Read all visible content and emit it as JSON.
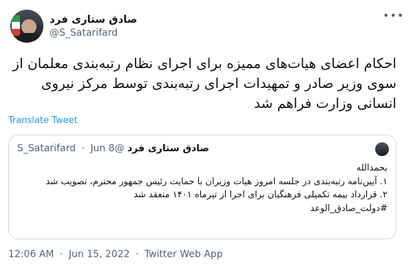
{
  "user": {
    "display_name": "صادق ستاری فرد",
    "handle": "@S_Satarifard"
  },
  "more_icon": "•••",
  "tweet": {
    "text": "احکام اعضای هیات‌های ممیزه برای اجرای نظام رتبه‌بندی معلمان از سوی وزیر صادر و تمهیدات اجرای رتبه‌بندی توسط مرکز نیروی انسانی وزارت فراهم شد"
  },
  "translate_label": "Translate Tweet",
  "quoted": {
    "display_name": "صادق ستاری فرد",
    "handle": "@S_Satarifard",
    "date": "Jun 8",
    "lines": [
      "بحمدالله",
      "۱. آیین‌نامه رتبه‌بندی در جلسه امروز هیات وزیران با حمایت رئیس جمهور محترم، تصویب شد",
      "۲. قرارداد بیمه تکمیلی فرهنگیان برای اجرا از تیرماه ۱۴۰۱ منعقد شد",
      "#دولت_صادق_الوعد"
    ]
  },
  "footer": {
    "time": "12:06 AM",
    "date": "Jun 15, 2022",
    "source": "Twitter Web App"
  }
}
